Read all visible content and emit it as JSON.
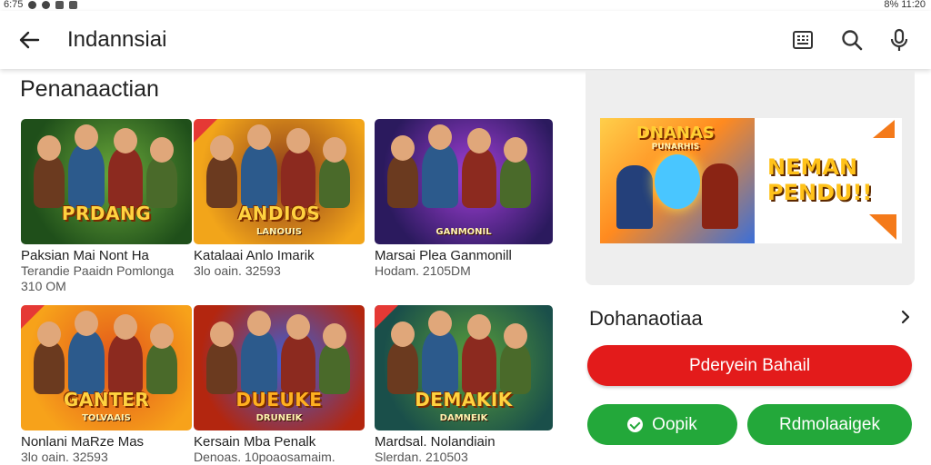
{
  "status_bar": {
    "time": "6:75",
    "right_text": "8% 11:20"
  },
  "header": {
    "title": "Indannsiai",
    "icons": [
      "back-arrow-icon",
      "grid-icon",
      "search-icon",
      "mic-icon"
    ]
  },
  "section": {
    "title": "Penanaactian"
  },
  "games": [
    {
      "logo": "PRDANG",
      "logo_sub": "",
      "title": "Paksian Mai Nont Ha",
      "meta1": "Terandie Paaidn Pomlonga",
      "meta2": "310 OM",
      "badge": false,
      "colors": [
        "#1f4f1a",
        "#6aa83a"
      ],
      "logo_color": "#ffd23f"
    },
    {
      "logo": "ANDIOS",
      "logo_sub": "LANOUIS",
      "title": "Katalaai Anlo Imarik",
      "meta1": "3lo oain. 32593",
      "meta2": "",
      "badge": true,
      "colors": [
        "#f2a51a",
        "#8a3b1a"
      ],
      "logo_color": "#ffd23f"
    },
    {
      "logo": "",
      "logo_sub": "GANMONIL",
      "title": "Marsai Plea Ganmonill",
      "meta1": "Hodam. 2105DM",
      "meta2": "",
      "badge": false,
      "colors": [
        "#2b1a5e",
        "#a23fd8"
      ],
      "logo_color": "#f2c94c"
    },
    {
      "logo": "GANTER",
      "logo_sub": "TOLVAAIS",
      "title": "Nonlani MaRze Mas",
      "meta1": "3lo oain. 32593",
      "meta2": "",
      "badge": true,
      "colors": [
        "#f7a21a",
        "#e2541a"
      ],
      "logo_color": "#ffd23f"
    },
    {
      "logo": "DUEUKE",
      "logo_sub": "DRUNEIK",
      "title": "Kersain Mba Penalk",
      "meta1": "Denoas. 10poaosamaim.",
      "meta2": "",
      "badge": false,
      "colors": [
        "#b3260f",
        "#3b5fd8"
      ],
      "logo_color": "#ffb020"
    },
    {
      "logo": "DEMAKIK",
      "logo_sub": "DAMNEIK",
      "title": "Mardsal. Nolandiain",
      "meta1": "Slerdan. 210503",
      "meta2": "",
      "badge": true,
      "colors": [
        "#1a4f4a",
        "#5aa03a"
      ],
      "logo_color": "#ffd23f"
    }
  ],
  "banner": {
    "logo": "DNANAS",
    "logo_sub": "PUNARHIS",
    "text_line1": "NEMAN",
    "text_line2": "PENDU!!"
  },
  "more_row": {
    "label": "Dohanaotiaa"
  },
  "buttons": {
    "primary": "Pderyein Bahail",
    "check": "Oopik",
    "secondary": "Rdmolaaigek"
  },
  "colors": {
    "red": "#e31b1b",
    "green": "#23a83a"
  }
}
